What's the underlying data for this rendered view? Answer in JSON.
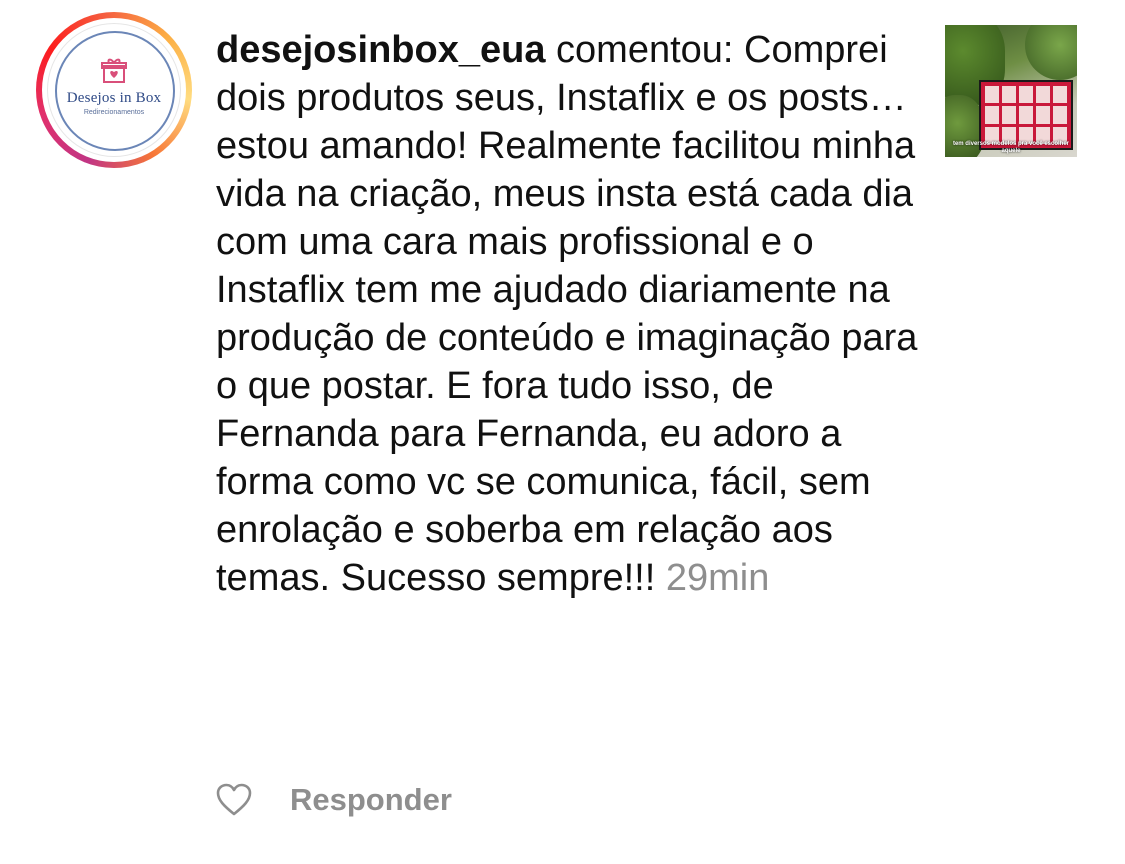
{
  "profile": {
    "avatar_brand": "Desejos in Box",
    "avatar_sub": "Redirecionamentos",
    "avatar_icon": "gift-heart-icon"
  },
  "comment": {
    "username": "desejosinbox_eua",
    "verb": "comentou:",
    "text": "Comprei dois produtos seus, Instaflix e os posts… estou amando! Realmente facilitou minha vida na criação, meus insta está cada dia com uma cara mais profissional e o Instaflix tem me ajudado diariamente na produção de conteúdo e imaginação para o que postar. E fora tudo isso, de Fernanda para Fernanda, eu adoro a forma como vc se comunica, fácil, sem enrolação e soberba em relação aos temas. Sucesso sempre!!!",
    "timestamp": "29min"
  },
  "post_thumbnail": {
    "caption": "tem diversos modelos pra você escolher aquele"
  },
  "actions": {
    "like_icon": "heart-outline-icon",
    "reply_label": "Responder"
  },
  "colors": {
    "text": "#111111",
    "muted": "#8e8e8e",
    "story_ring_start": "#c13584",
    "story_ring_end": "#fcaf45"
  }
}
